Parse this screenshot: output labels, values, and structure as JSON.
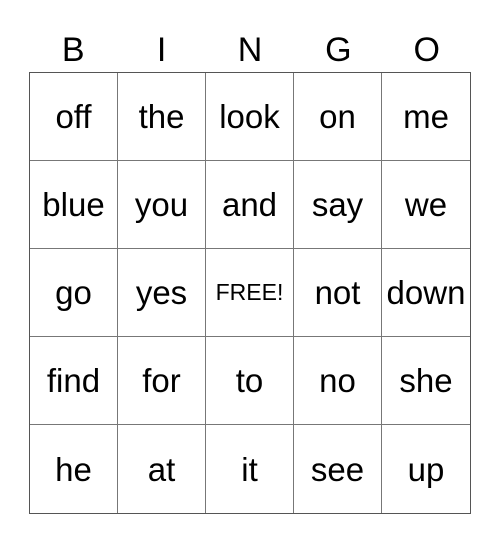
{
  "header": {
    "letters": [
      "B",
      "I",
      "N",
      "G",
      "O"
    ]
  },
  "card": {
    "rows": [
      [
        "off",
        "the",
        "look",
        "on",
        "me"
      ],
      [
        "blue",
        "you",
        "and",
        "say",
        "we"
      ],
      [
        "go",
        "yes",
        "FREE!",
        "not",
        "down"
      ],
      [
        "find",
        "for",
        "to",
        "no",
        "she"
      ],
      [
        "he",
        "at",
        "it",
        "see",
        "up"
      ]
    ],
    "free_space": {
      "row": 2,
      "col": 2,
      "label": "FREE!"
    }
  },
  "colors": {
    "background": "#ffffff",
    "text": "#000000",
    "grid_line": "#777777"
  }
}
